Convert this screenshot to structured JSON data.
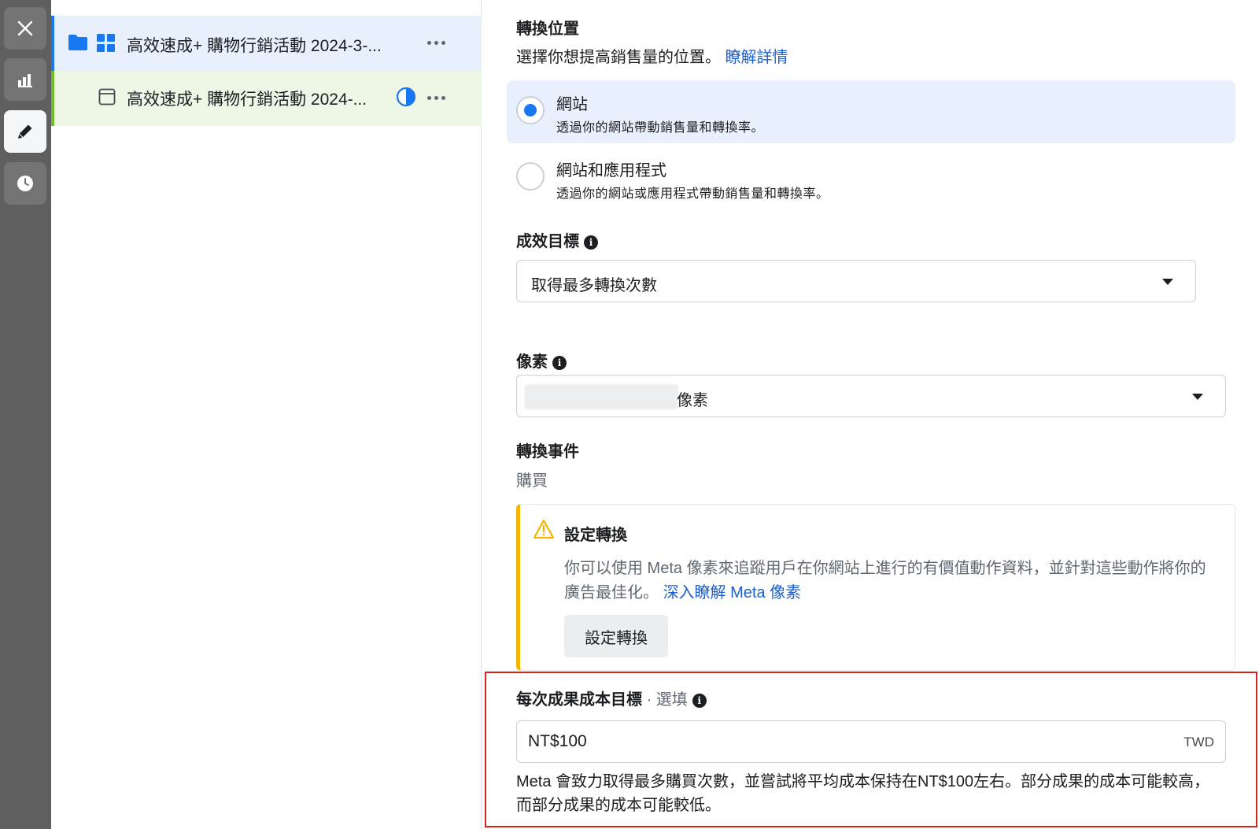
{
  "rail": {
    "buttons": [
      "close-icon",
      "chart-icon",
      "pencil-icon",
      "clock-icon"
    ]
  },
  "tree": {
    "campaign": {
      "label": "高效速成+ 購物行銷活動 2024-3-..."
    },
    "adset": {
      "label": "高效速成+ 購物行銷活動 2024-..."
    }
  },
  "form": {
    "conversion_location": {
      "label": "轉換位置",
      "hint": "選擇你想提高銷售量的位置。",
      "learn_more": "瞭解詳情",
      "options": [
        {
          "title": "網站",
          "desc": "透過你的網站帶動銷售量和轉換率。",
          "selected": true
        },
        {
          "title": "網站和應用程式",
          "desc": "透過你的網站或應用程式帶動銷售量和轉換率。",
          "selected": false
        }
      ]
    },
    "performance_goal": {
      "label": "成效目標",
      "value": "取得最多轉換次數"
    },
    "pixel": {
      "label": "像素",
      "value": "像素"
    },
    "conversion_event": {
      "label": "轉換事件",
      "value": "購買"
    },
    "setup_warning": {
      "title": "設定轉換",
      "body": "你可以使用 Meta 像素來追蹤用戶在你網站上進行的有價值動作資料，並針對這些動作將你的廣告最佳化。",
      "link": "深入瞭解 Meta 像素",
      "button": "設定轉換"
    },
    "cost_per_result": {
      "label": "每次成果成本目標",
      "optional": "· 選填",
      "value": "NT$100",
      "currency": "TWD",
      "description": "Meta 會致力取得最多購買次數，並嘗試將平均成本保持在NT$100左右。部分成果的成本可能較高，而部分成果的成本可能較低。"
    }
  },
  "colors": {
    "accent": "#1877f2",
    "link": "#1d5fcc",
    "warning": "#f5b400",
    "highlight_border": "#d9241e"
  }
}
